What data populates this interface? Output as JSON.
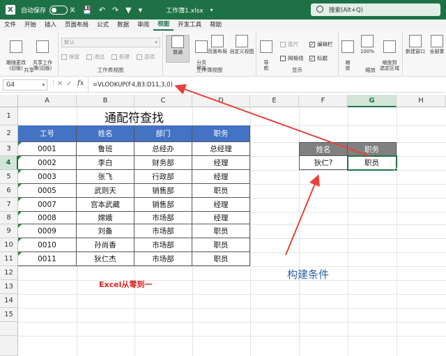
{
  "titlebar": {
    "app_icon": "X",
    "autosave_label": "自动保存",
    "autosave_state": "关",
    "document": "工作簿1.xlsx",
    "search_placeholder": "搜索(Alt+Q)"
  },
  "menu": [
    "文件",
    "开始",
    "插入",
    "页面布局",
    "公式",
    "数据",
    "审阅",
    "视图",
    "开发工具",
    "帮助"
  ],
  "ribbon": {
    "sheet_view": {
      "label": "工作表视图",
      "keep_btn": "跟随更改\n(旧版)",
      "share_btn": "共享工作\n簿(旧版)",
      "dropdown_value": "默认",
      "keep": "保留",
      "exit": "退出",
      "new": "新建",
      "options": "选项"
    },
    "share_group_label": "共享",
    "workbook_views": {
      "label": "工作簿视图",
      "normal": "普通",
      "page_break": "分页\n预览",
      "page_layout": "页面布局",
      "custom": "自定义视图"
    },
    "show": {
      "label": "显示",
      "nav": "导\n航",
      "ruler": "直尺",
      "gridlines": "网格线",
      "formula_bar": "编辑栏",
      "headings": "标题"
    },
    "zoom": {
      "label": "缩放",
      "zoom": "缩\n放",
      "hundred": "100%",
      "to_selection": "缩放到\n选定区域"
    },
    "window": {
      "new_window": "新建窗口",
      "arrange": "全部重"
    }
  },
  "formula_bar": {
    "name_box": "G4",
    "fx": "fx",
    "formula": "=VLOOKUP(F4,B3:D11,3,0)"
  },
  "columns": [
    "A",
    "B",
    "C",
    "D",
    "E",
    "F",
    "G",
    "H"
  ],
  "rows": [
    "1",
    "2",
    "3",
    "4",
    "5",
    "6",
    "7",
    "8",
    "9",
    "10",
    "11",
    "12",
    "13",
    "14",
    "15"
  ],
  "table": {
    "title": "通配符查找",
    "headers": [
      "工号",
      "姓名",
      "部门",
      "职务"
    ],
    "rows": [
      [
        "0001",
        "鲁班",
        "总经办",
        "总经理"
      ],
      [
        "0002",
        "李白",
        "财务部",
        "经理"
      ],
      [
        "0003",
        "张飞",
        "行政部",
        "经理"
      ],
      [
        "0005",
        "武则天",
        "销售部",
        "职员"
      ],
      [
        "0007",
        "宫本武藏",
        "销售部",
        "经理"
      ],
      [
        "0008",
        "嫦娥",
        "市场部",
        "经理"
      ],
      [
        "0009",
        "刘备",
        "市场部",
        "职员"
      ],
      [
        "0010",
        "孙尚香",
        "市场部",
        "职员"
      ],
      [
        "0011",
        "狄仁杰",
        "市场部",
        "职员"
      ]
    ]
  },
  "lookup": {
    "headers": [
      "姓名",
      "职务"
    ],
    "criteria": "狄仁?",
    "result": "职员"
  },
  "annotations": {
    "watermark": "Excel从零到一",
    "note": "构建条件",
    "arrow_color": "#e8413a"
  }
}
